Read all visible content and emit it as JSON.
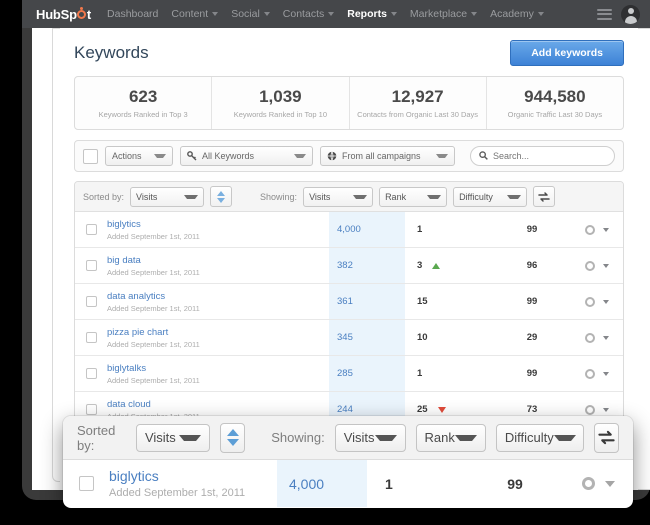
{
  "nav": {
    "logo_text_a": "HubSp",
    "logo_text_b": "t",
    "items": [
      {
        "label": "Dashboard",
        "has_caret": false,
        "active": false
      },
      {
        "label": "Content",
        "has_caret": true,
        "active": false
      },
      {
        "label": "Social",
        "has_caret": true,
        "active": false
      },
      {
        "label": "Contacts",
        "has_caret": true,
        "active": false
      },
      {
        "label": "Reports",
        "has_caret": true,
        "active": true
      },
      {
        "label": "Marketplace",
        "has_caret": true,
        "active": false
      },
      {
        "label": "Academy",
        "has_caret": true,
        "active": false
      }
    ]
  },
  "header": {
    "title": "Keywords",
    "add_button": "Add keywords"
  },
  "stats": [
    {
      "value": "623",
      "label": "Keywords Ranked in Top 3"
    },
    {
      "value": "1,039",
      "label": "Keywords Ranked in Top 10"
    },
    {
      "value": "12,927",
      "label": "Contacts from Organic Last 30 Days"
    },
    {
      "value": "944,580",
      "label": "Organic Traffic Last 30 Days"
    }
  ],
  "filters": {
    "actions_label": "Actions",
    "keywords_label": "All Keywords",
    "campaigns_label": "From all campaigns",
    "search_placeholder": "Search...",
    "search_value": ""
  },
  "sortbar": {
    "sorted_by_label": "Sorted by:",
    "sorted_by_value": "Visits",
    "showing_label": "Showing:",
    "col_visits": "Visits",
    "col_rank": "Rank",
    "col_difficulty": "Difficulty"
  },
  "rows": [
    {
      "keyword": "biglytics",
      "date": "Added September 1st, 2011",
      "visits": "4,000",
      "rank": "1",
      "trend": "none",
      "difficulty": "99"
    },
    {
      "keyword": "big data",
      "date": "Added September 1st, 2011",
      "visits": "382",
      "rank": "3",
      "trend": "up",
      "difficulty": "96"
    },
    {
      "keyword": "data analytics",
      "date": "Added September 1st, 2011",
      "visits": "361",
      "rank": "15",
      "trend": "none",
      "difficulty": "99"
    },
    {
      "keyword": "pizza pie chart",
      "date": "Added September 1st, 2011",
      "visits": "345",
      "rank": "10",
      "trend": "none",
      "difficulty": "29"
    },
    {
      "keyword": "biglytalks",
      "date": "Added September 1st, 2011",
      "visits": "285",
      "rank": "1",
      "trend": "none",
      "difficulty": "99"
    },
    {
      "keyword": "data cloud",
      "date": "Added September 1st, 2011",
      "visits": "244",
      "rank": "25",
      "trend": "down",
      "difficulty": "73"
    },
    {
      "keyword": "biglytics",
      "date": "Added September 1st, 2011",
      "visits": "",
      "rank": "",
      "trend": "none",
      "difficulty": ""
    }
  ],
  "overlay": {
    "sorted_by_label": "Sorted by:",
    "sorted_by_value": "Visits",
    "showing_label": "Showing:",
    "col_visits": "Visits",
    "col_rank": "Rank",
    "col_difficulty": "Difficulty",
    "row": {
      "keyword": "biglytics",
      "date": "Added September 1st, 2011",
      "visits": "4,000",
      "rank": "1",
      "difficulty": "99"
    }
  },
  "colors": {
    "nav_bg": "#45474a",
    "accent_orange": "#f2784b",
    "link_blue": "#4a7fc1",
    "button_blue": "#3d82d6",
    "visits_column_bg": "#eaf4fc",
    "trend_up": "#5aa84f",
    "trend_down": "#e04b3a"
  }
}
